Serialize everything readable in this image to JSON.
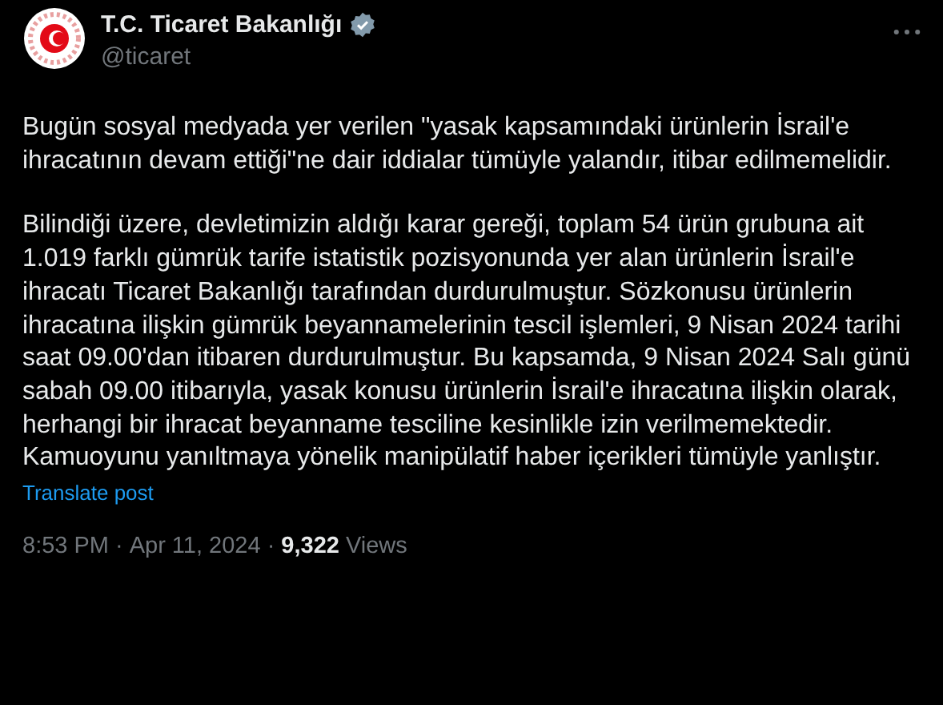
{
  "author": {
    "name": "T.C. Ticaret Bakanlığı",
    "verified": true,
    "handle": "@ticaret"
  },
  "paragraphs": [
    "Bugün sosyal medyada yer verilen \"yasak kapsamındaki ürünlerin İsrail'e ihracatının devam ettiği\"ne dair iddialar tümüyle yalandır, itibar edilmemelidir.",
    "Bilindiği üzere, devletimizin aldığı karar gereği, toplam 54 ürün grubuna ait 1.019 farklı gümrük tarife istatistik pozisyonunda yer alan ürünlerin İsrail'e ihracatı Ticaret Bakanlığı tarafından durdurulmuştur. Sözkonusu ürünlerin ihracatına ilişkin gümrük beyannamelerinin tescil işlemleri, 9 Nisan 2024 tarihi saat 09.00'dan itibaren durdurulmuştur. Bu kapsamda, 9 Nisan 2024 Salı günü sabah 09.00 itibarıyla, yasak konusu ürünlerin İsrail'e ihracatına ilişkin olarak, herhangi bir ihracat beyanname tesciline kesinlikle izin verilmemektedir. Kamuoyunu yanıltmaya yönelik manipülatif haber içerikleri tümüyle yanlıştır."
  ],
  "translate_link": "Translate post",
  "meta": {
    "time": "8:53 PM",
    "separator_1": "·",
    "date": "Apr 11, 2024",
    "separator_2": "·",
    "views_count": "9,322",
    "views_label": "Views"
  }
}
